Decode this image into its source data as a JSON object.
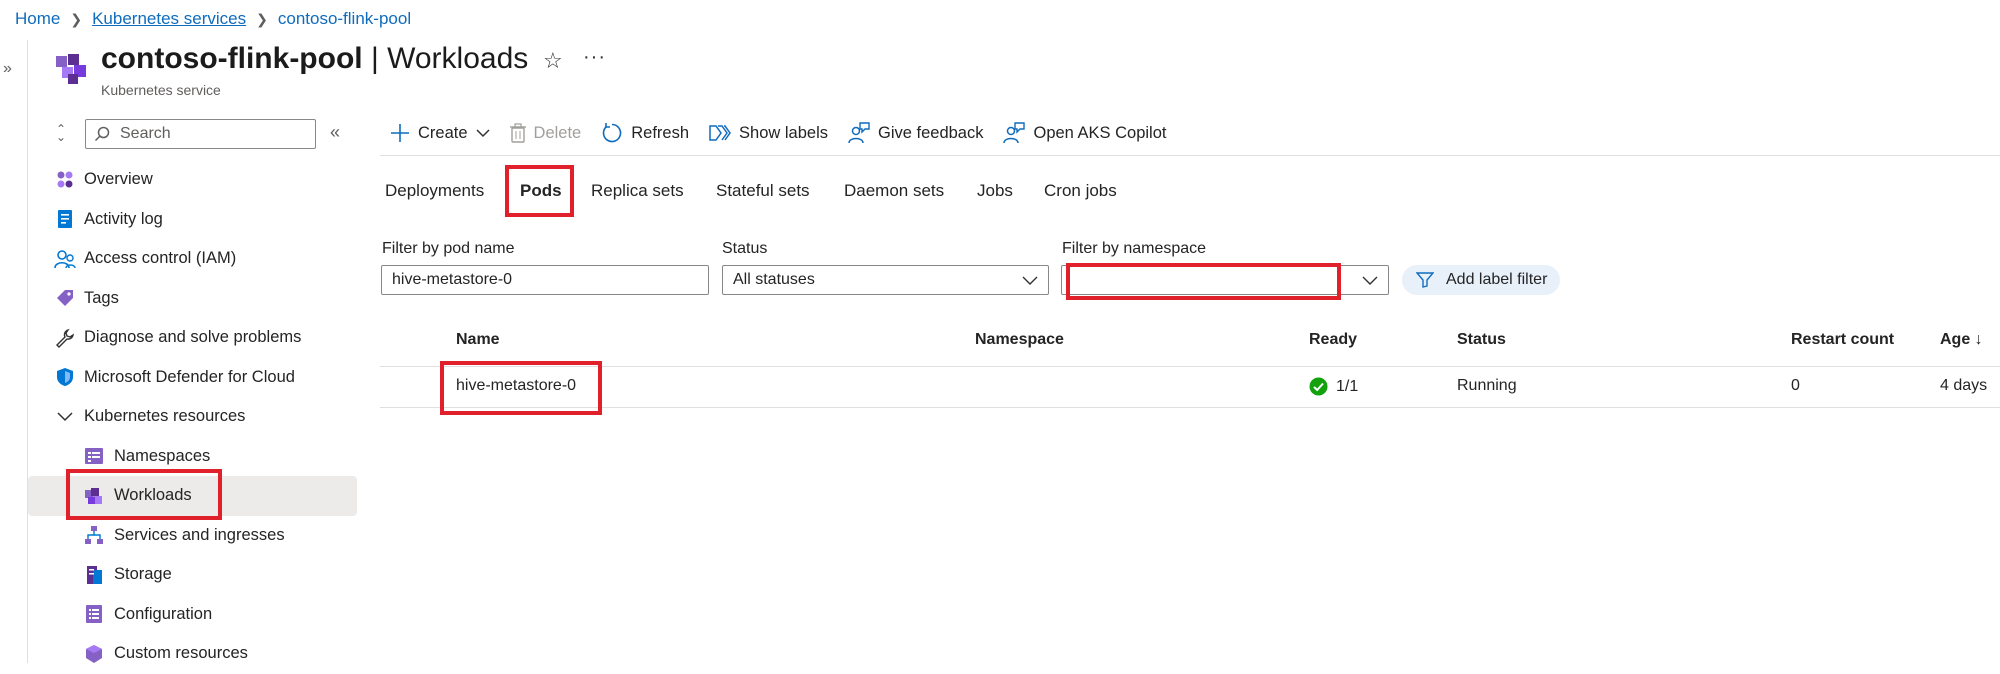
{
  "breadcrumb": [
    "Home",
    "Kubernetes services",
    "contoso-flink-pool"
  ],
  "header": {
    "resource_name": "contoso-flink-pool",
    "separator": " | ",
    "page": "Workloads",
    "subtitle": "Kubernetes service"
  },
  "sidebar": {
    "search_placeholder": "Search",
    "items": [
      {
        "label": "Overview",
        "icon": "overview-icon"
      },
      {
        "label": "Activity log",
        "icon": "activity-log-icon"
      },
      {
        "label": "Access control (IAM)",
        "icon": "iam-icon"
      },
      {
        "label": "Tags",
        "icon": "tag-icon"
      },
      {
        "label": "Diagnose and solve problems",
        "icon": "wrench-icon"
      },
      {
        "label": "Microsoft Defender for Cloud",
        "icon": "shield-icon"
      },
      {
        "label": "Kubernetes resources",
        "icon": "chevron-down-icon",
        "expanded": true
      },
      {
        "label": "Namespaces",
        "icon": "namespaces-icon"
      },
      {
        "label": "Workloads",
        "icon": "workloads-icon",
        "selected": true
      },
      {
        "label": "Services and ingresses",
        "icon": "network-icon"
      },
      {
        "label": "Storage",
        "icon": "storage-icon"
      },
      {
        "label": "Configuration",
        "icon": "configuration-icon"
      },
      {
        "label": "Custom resources",
        "icon": "custom-resources-icon"
      }
    ]
  },
  "toolbar": {
    "create": "Create",
    "delete": "Delete",
    "refresh": "Refresh",
    "show_labels": "Show labels",
    "give_feedback": "Give feedback",
    "open_copilot": "Open AKS Copilot"
  },
  "tabs": [
    {
      "label": "Deployments"
    },
    {
      "label": "Pods",
      "active": true
    },
    {
      "label": "Replica sets"
    },
    {
      "label": "Stateful sets"
    },
    {
      "label": "Daemon sets"
    },
    {
      "label": "Jobs"
    },
    {
      "label": "Cron jobs"
    }
  ],
  "filters": {
    "pod_name_label": "Filter by pod name",
    "pod_name_value": "hive-metastore-0",
    "status_label": "Status",
    "status_value": "All statuses",
    "namespace_label": "Filter by namespace",
    "namespace_value": "",
    "add_label_filter": "Add label filter"
  },
  "table": {
    "columns": [
      "Name",
      "Namespace",
      "Ready",
      "Status",
      "Restart count",
      "Age ↓"
    ],
    "rows": [
      {
        "name": "hive-metastore-0",
        "namespace": "",
        "ready": "1/1",
        "status": "Running",
        "restart_count": "0",
        "age": "4 days"
      }
    ]
  },
  "colors": {
    "link": "#0f6cbd",
    "highlight": "#e0202a",
    "success": "#13a10e",
    "azure_purple": "#8661c5"
  }
}
